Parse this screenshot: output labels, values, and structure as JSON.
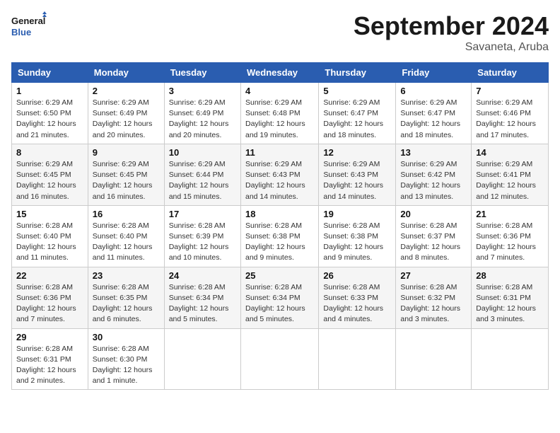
{
  "logo": {
    "line1": "General",
    "line2": "Blue"
  },
  "title": "September 2024",
  "location": "Savaneta, Aruba",
  "weekdays": [
    "Sunday",
    "Monday",
    "Tuesday",
    "Wednesday",
    "Thursday",
    "Friday",
    "Saturday"
  ],
  "weeks": [
    [
      {
        "day": "1",
        "info": "Sunrise: 6:29 AM\nSunset: 6:50 PM\nDaylight: 12 hours\nand 21 minutes."
      },
      {
        "day": "2",
        "info": "Sunrise: 6:29 AM\nSunset: 6:49 PM\nDaylight: 12 hours\nand 20 minutes."
      },
      {
        "day": "3",
        "info": "Sunrise: 6:29 AM\nSunset: 6:49 PM\nDaylight: 12 hours\nand 20 minutes."
      },
      {
        "day": "4",
        "info": "Sunrise: 6:29 AM\nSunset: 6:48 PM\nDaylight: 12 hours\nand 19 minutes."
      },
      {
        "day": "5",
        "info": "Sunrise: 6:29 AM\nSunset: 6:47 PM\nDaylight: 12 hours\nand 18 minutes."
      },
      {
        "day": "6",
        "info": "Sunrise: 6:29 AM\nSunset: 6:47 PM\nDaylight: 12 hours\nand 18 minutes."
      },
      {
        "day": "7",
        "info": "Sunrise: 6:29 AM\nSunset: 6:46 PM\nDaylight: 12 hours\nand 17 minutes."
      }
    ],
    [
      {
        "day": "8",
        "info": "Sunrise: 6:29 AM\nSunset: 6:45 PM\nDaylight: 12 hours\nand 16 minutes."
      },
      {
        "day": "9",
        "info": "Sunrise: 6:29 AM\nSunset: 6:45 PM\nDaylight: 12 hours\nand 16 minutes."
      },
      {
        "day": "10",
        "info": "Sunrise: 6:29 AM\nSunset: 6:44 PM\nDaylight: 12 hours\nand 15 minutes."
      },
      {
        "day": "11",
        "info": "Sunrise: 6:29 AM\nSunset: 6:43 PM\nDaylight: 12 hours\nand 14 minutes."
      },
      {
        "day": "12",
        "info": "Sunrise: 6:29 AM\nSunset: 6:43 PM\nDaylight: 12 hours\nand 14 minutes."
      },
      {
        "day": "13",
        "info": "Sunrise: 6:29 AM\nSunset: 6:42 PM\nDaylight: 12 hours\nand 13 minutes."
      },
      {
        "day": "14",
        "info": "Sunrise: 6:29 AM\nSunset: 6:41 PM\nDaylight: 12 hours\nand 12 minutes."
      }
    ],
    [
      {
        "day": "15",
        "info": "Sunrise: 6:28 AM\nSunset: 6:40 PM\nDaylight: 12 hours\nand 11 minutes."
      },
      {
        "day": "16",
        "info": "Sunrise: 6:28 AM\nSunset: 6:40 PM\nDaylight: 12 hours\nand 11 minutes."
      },
      {
        "day": "17",
        "info": "Sunrise: 6:28 AM\nSunset: 6:39 PM\nDaylight: 12 hours\nand 10 minutes."
      },
      {
        "day": "18",
        "info": "Sunrise: 6:28 AM\nSunset: 6:38 PM\nDaylight: 12 hours\nand 9 minutes."
      },
      {
        "day": "19",
        "info": "Sunrise: 6:28 AM\nSunset: 6:38 PM\nDaylight: 12 hours\nand 9 minutes."
      },
      {
        "day": "20",
        "info": "Sunrise: 6:28 AM\nSunset: 6:37 PM\nDaylight: 12 hours\nand 8 minutes."
      },
      {
        "day": "21",
        "info": "Sunrise: 6:28 AM\nSunset: 6:36 PM\nDaylight: 12 hours\nand 7 minutes."
      }
    ],
    [
      {
        "day": "22",
        "info": "Sunrise: 6:28 AM\nSunset: 6:36 PM\nDaylight: 12 hours\nand 7 minutes."
      },
      {
        "day": "23",
        "info": "Sunrise: 6:28 AM\nSunset: 6:35 PM\nDaylight: 12 hours\nand 6 minutes."
      },
      {
        "day": "24",
        "info": "Sunrise: 6:28 AM\nSunset: 6:34 PM\nDaylight: 12 hours\nand 5 minutes."
      },
      {
        "day": "25",
        "info": "Sunrise: 6:28 AM\nSunset: 6:34 PM\nDaylight: 12 hours\nand 5 minutes."
      },
      {
        "day": "26",
        "info": "Sunrise: 6:28 AM\nSunset: 6:33 PM\nDaylight: 12 hours\nand 4 minutes."
      },
      {
        "day": "27",
        "info": "Sunrise: 6:28 AM\nSunset: 6:32 PM\nDaylight: 12 hours\nand 3 minutes."
      },
      {
        "day": "28",
        "info": "Sunrise: 6:28 AM\nSunset: 6:31 PM\nDaylight: 12 hours\nand 3 minutes."
      }
    ],
    [
      {
        "day": "29",
        "info": "Sunrise: 6:28 AM\nSunset: 6:31 PM\nDaylight: 12 hours\nand 2 minutes."
      },
      {
        "day": "30",
        "info": "Sunrise: 6:28 AM\nSunset: 6:30 PM\nDaylight: 12 hours\nand 1 minute."
      },
      null,
      null,
      null,
      null,
      null
    ]
  ]
}
